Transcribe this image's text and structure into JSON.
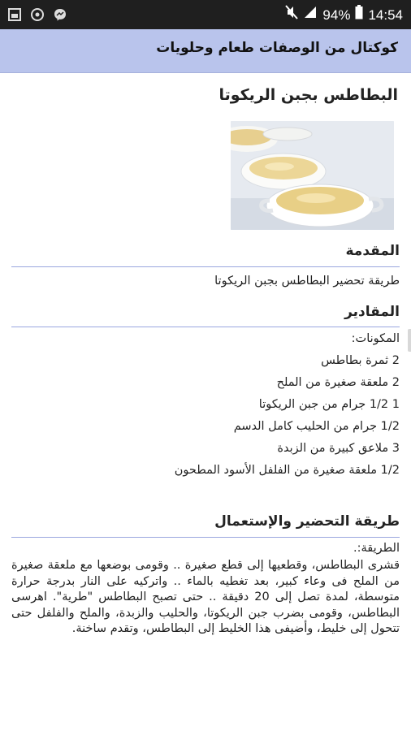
{
  "status_bar": {
    "battery": "94%",
    "time": "14:54",
    "icons": [
      "gallery-icon",
      "whatsapp-icon",
      "messenger-icon",
      "mute-icon",
      "signal-icon",
      "battery-icon"
    ]
  },
  "app_bar": {
    "title": "كوكتال من الوصفات طعام وحلويات"
  },
  "recipe": {
    "title": "البطاطس بجبن الريكوتا",
    "intro_heading": "المقدمة",
    "intro_text": "طريقة تحضير البطاطس بجبن الريكوتا",
    "ingredients_heading": "المقادير",
    "ingredients_label": "المكونات:",
    "ingredients": [
      "2 ثمرة بطاطس",
      "2 ملعقة صغيرة من الملح",
      "1 1/2 جرام من جبن الريكوتا",
      "1/2 جرام من الحليب كامل الدسم",
      "3 ملاعق كبيرة من الزبدة",
      "1/2 ملعقة صغيرة من الفلفل الأسود المطحون"
    ],
    "method_heading": "طريقة التحضير والإستعمال",
    "method_label": "الطريقة:.",
    "method_text": "قشرى البطاطس، وقطعيها إلى قطع صغيرة .. وقومى بوضعها مع ملعقة صغيرة من الملح فى وعاء كبير، بعد تغطيه بالماء .. واتركيه على النار بدرجة حرارة متوسطة، لمدة تصل إلى 20 دقيقة .. حتى تصبح البطاطس \"طرية\". اهرسى البطاطس، وقومى بضرب جبن الريكوتا، والحليب والزبدة، والملح والفلفل حتى تتحول إلى خليط، وأضيفى هذا الخليط إلى البطاطس، وتقدم ساخنة."
  }
}
